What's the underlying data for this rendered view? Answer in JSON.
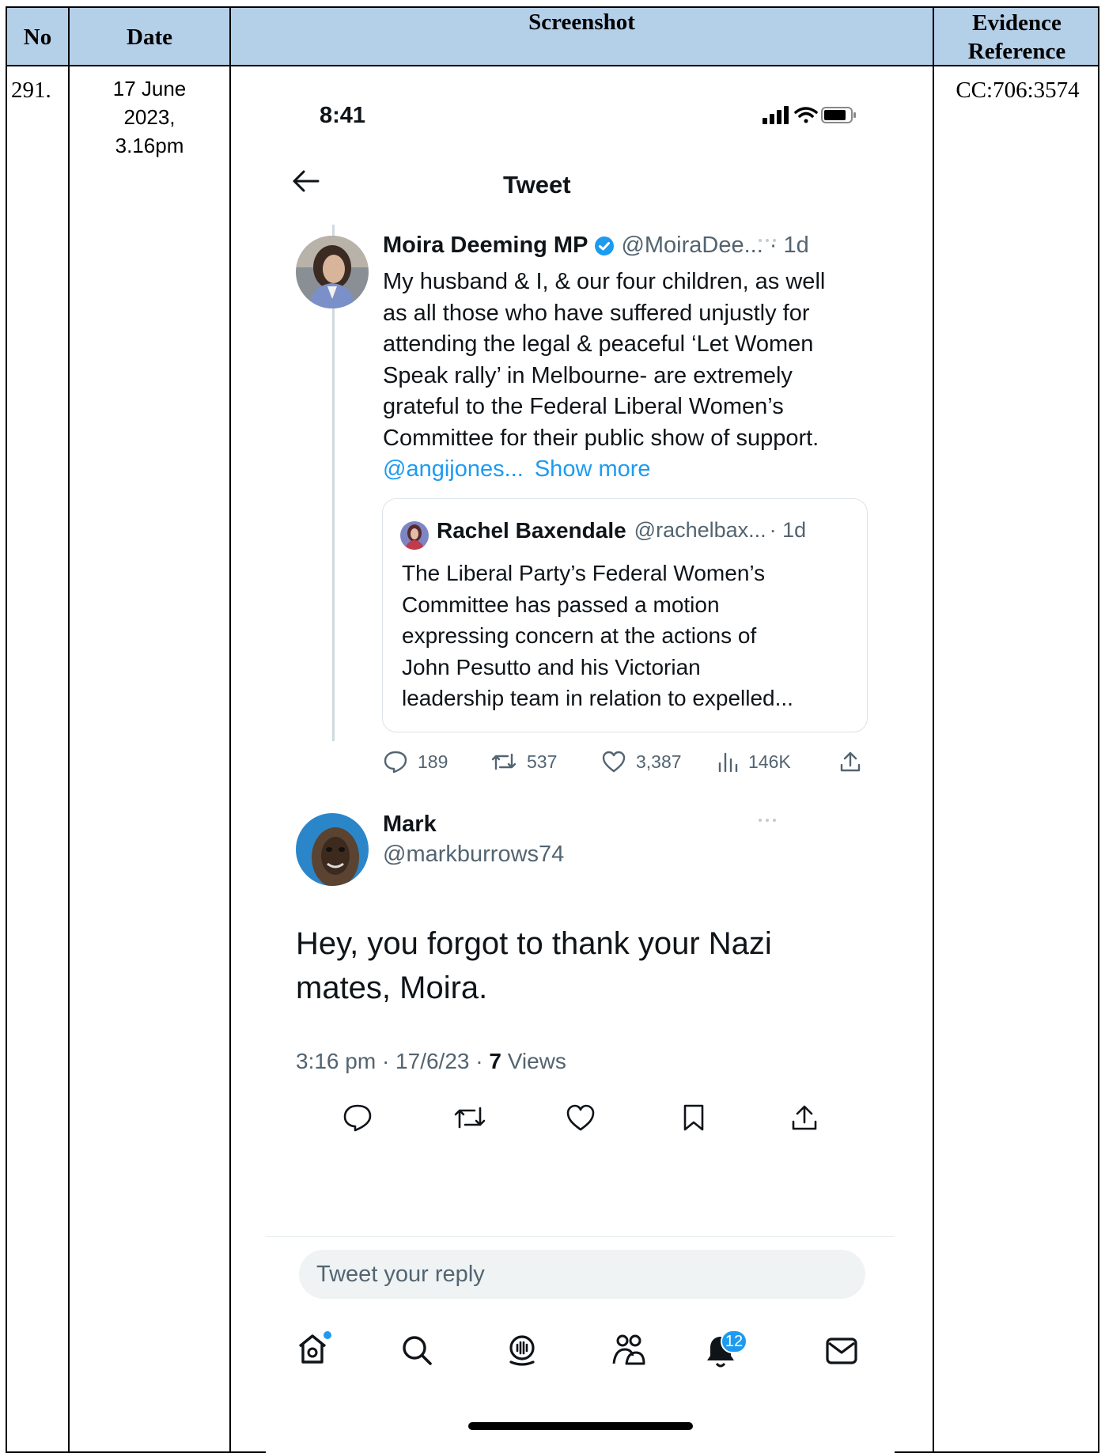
{
  "table": {
    "headers": {
      "no": "No",
      "date": "Date",
      "screenshot": "Screenshot",
      "evidence_line1": "Evidence",
      "evidence_line2": "Reference"
    },
    "row": {
      "no": "291.",
      "date_line1": "17 June",
      "date_line2": "2023,",
      "date_line3": "3.16pm",
      "evidence": "CC:706:3574"
    }
  },
  "phone": {
    "status_time": "8:41",
    "header_title": "Tweet",
    "tweet": {
      "author_name": "Moira Deeming MP",
      "author_handle": "@MoiraDee...",
      "age": "· 1d",
      "verified": true,
      "text_lines": [
        "My husband & I, & our four children, as well",
        "as all those who have suffered unjustly for",
        "attending the legal & peaceful ‘Let Women",
        "Speak rally’ in Melbourne- are extremely",
        "grateful to the Federal Liberal Women’s",
        "Committee for their public show of support."
      ],
      "mention": "@angijones...",
      "show_more": "Show more",
      "quote": {
        "author_name": "Rachel Baxendale",
        "author_handle": "@rachelbax...",
        "age": "· 1d",
        "text_lines": [
          "The Liberal Party’s Federal Women’s",
          "Committee has passed a motion",
          "expressing concern at the actions of",
          "John Pesutto and his Victorian",
          "leadership team in relation to expelled..."
        ]
      },
      "stats": {
        "replies": "189",
        "retweets": "537",
        "likes": "3,387",
        "views": "146K"
      }
    },
    "reply": {
      "author_name": "Mark",
      "author_handle": "@markburrows74",
      "text_line1": "Hey, you forgot to thank your Nazi",
      "text_line2": "mates, Moira.",
      "meta_prefix": "3:16 pm · 17/6/23 · ",
      "views_count": "7",
      "views_label": " Views"
    },
    "reply_placeholder": "Tweet your reply",
    "notification_count": "12",
    "accent_color": "#1d9bf0"
  }
}
